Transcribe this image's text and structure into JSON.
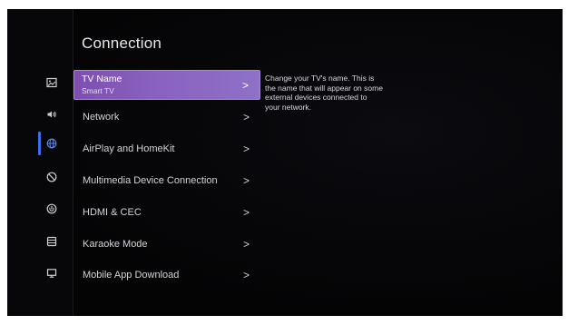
{
  "page": {
    "title": "Connection"
  },
  "sidebar": {
    "items": [
      {
        "icon": "picture-icon",
        "active": false
      },
      {
        "icon": "sound-icon",
        "active": false
      },
      {
        "icon": "globe-icon",
        "active": true
      },
      {
        "icon": "accessibility-icon",
        "active": false
      },
      {
        "icon": "power-icon",
        "active": false
      },
      {
        "icon": "storage-icon",
        "active": false
      },
      {
        "icon": "screen-icon",
        "active": false
      }
    ]
  },
  "menu": {
    "items": [
      {
        "label": "TV Name",
        "sublabel": "Smart TV",
        "chevron": ">"
      },
      {
        "label": "Network",
        "chevron": ">"
      },
      {
        "label": "AirPlay and HomeKit",
        "chevron": ">"
      },
      {
        "label": "Multimedia Device Connection",
        "chevron": ">"
      },
      {
        "label": "HDMI & CEC",
        "chevron": ">"
      },
      {
        "label": "Karaoke Mode",
        "chevron": ">"
      },
      {
        "label": "Mobile App Download",
        "chevron": ">"
      }
    ]
  },
  "help": {
    "text": "Change your TV's name. This is the name that will appear on some external devices connected to your network."
  },
  "colors": {
    "selected_gradient_start": "#7d4fb0",
    "selected_gradient_end": "#8e71c8",
    "active_indicator": "#3a6ee8",
    "background": "#050507"
  }
}
